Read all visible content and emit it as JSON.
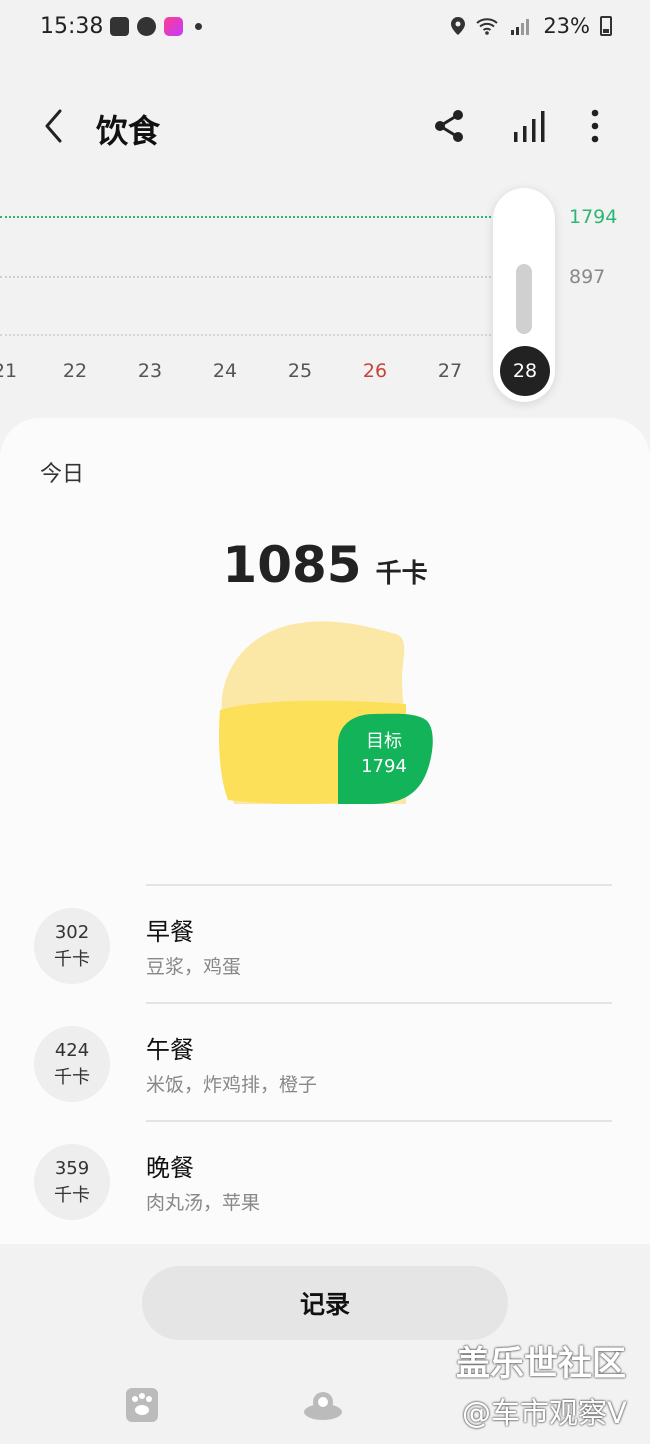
{
  "status_bar": {
    "time": "15:38",
    "battery": "23%",
    "icons": [
      "gallery-icon",
      "check-icon",
      "shop-icon",
      "location-icon",
      "wifi-icon",
      "signal-icon",
      "battery-icon"
    ]
  },
  "header": {
    "title": "饮食",
    "back_icon": "chevron-left-icon",
    "share_icon": "share-icon",
    "stats_icon": "bar-chart-icon",
    "more_icon": "more-vertical-icon"
  },
  "chart": {
    "goal_label": "1794",
    "mid_label": "897",
    "days": [
      "21",
      "22",
      "23",
      "24",
      "25",
      "26",
      "27"
    ],
    "selected_day": "28",
    "sunday_day": "26",
    "selected_fill_fraction": 0.6,
    "goal_color": "#2bb673",
    "sunday_color": "#c8433a"
  },
  "today": {
    "title": "今日",
    "total_value": "1085",
    "total_unit": "千卡",
    "goal_label": "目标",
    "goal_value": "1794",
    "blob_colors": {
      "light": "#fbe8a6",
      "main": "#fde05a",
      "goal": "#13b35a"
    }
  },
  "meals": [
    {
      "kcal": "302",
      "unit": "千卡",
      "name": "早餐",
      "foods": "豆浆，鸡蛋"
    },
    {
      "kcal": "424",
      "unit": "千卡",
      "name": "午餐",
      "foods": "米饭，炸鸡排，橙子"
    },
    {
      "kcal": "359",
      "unit": "千卡",
      "name": "晚餐",
      "foods": "肉丸汤，苹果"
    }
  ],
  "record_button": "记录",
  "bottom_nav": {
    "left_icon": "paw-icon",
    "center_icon": "food-bowl-icon"
  },
  "watermark": {
    "line1": "盖乐世社区",
    "line2": "@车市观察V"
  }
}
